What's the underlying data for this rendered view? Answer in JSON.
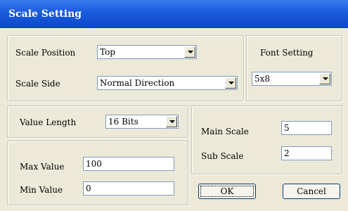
{
  "window": {
    "title": "Scale Setting"
  },
  "scale_group": {
    "position_label": "Scale Position",
    "position_value": "Top",
    "side_label": "Scale Side",
    "side_value": "Normal Direction"
  },
  "font_group": {
    "label": "Font Setting",
    "value": "5x8"
  },
  "value_length": {
    "label": "Value Length",
    "value": "16 Bits"
  },
  "range": {
    "max_label": "Max Value",
    "max_value": "100",
    "min_label": "Min Value",
    "min_value": "0"
  },
  "scales": {
    "main_label": "Main Scale",
    "main_value": "5",
    "sub_label": "Sub Scale",
    "sub_value": "2"
  },
  "buttons": {
    "ok": "OK",
    "cancel": "Cancel"
  },
  "colors": {
    "titlebar": "#0a48c8",
    "dialog_bg": "#ece9d8",
    "field_border": "#7f9db9"
  }
}
